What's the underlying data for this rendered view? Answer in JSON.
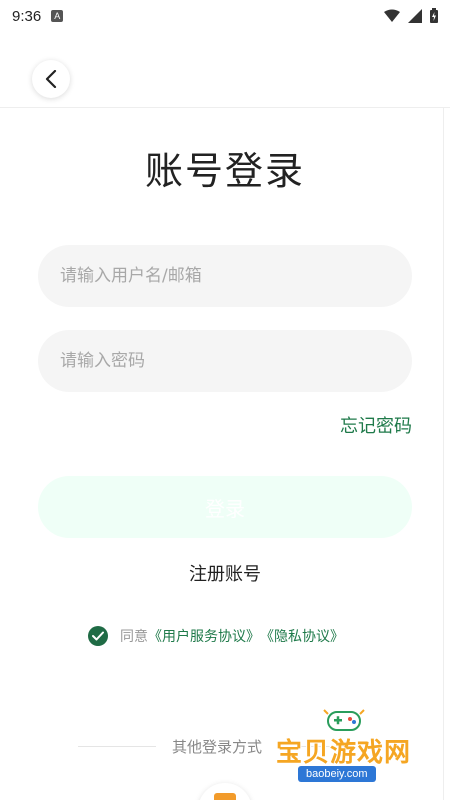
{
  "status_bar": {
    "time": "9:36",
    "notification_glyph": "A",
    "icons": [
      "wifi-icon",
      "signal-icon",
      "battery-icon"
    ]
  },
  "header": {
    "back_icon": "chevron-left-icon"
  },
  "title": "账号登录",
  "form": {
    "username_placeholder": "请输入用户名/邮箱",
    "username_value": "",
    "password_placeholder": "请输入密码",
    "password_value": "",
    "forgot_label": "忘记密码",
    "login_label": "登录",
    "register_label": "注册账号"
  },
  "agreement": {
    "checked": true,
    "prefix": "同意",
    "service_link": "《用户服务协议》",
    "privacy_link": "《隐私协议》"
  },
  "other_login": {
    "label": "其他登录方式"
  },
  "watermark": {
    "text": "宝贝游戏网",
    "url": "baobeiy.com"
  },
  "colors": {
    "accent": "#1f7a4a",
    "check": "#1f6b45",
    "login_bg": "#effff7",
    "input_bg": "#f5f5f5"
  }
}
